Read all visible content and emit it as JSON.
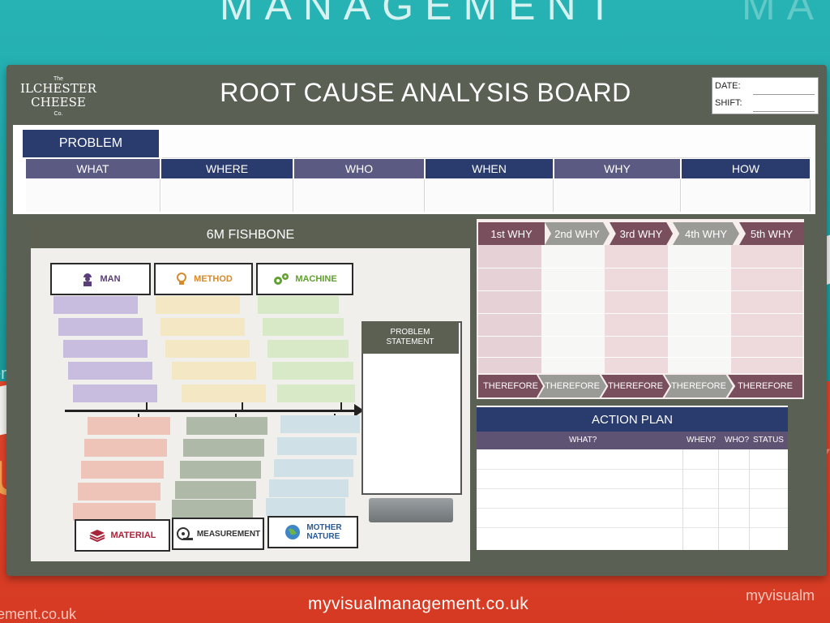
{
  "wall": {
    "top_text": "MANAGEMENT",
    "right_text": "MA",
    "left_text": "ent.c",
    "url": "myvisualmanagement.co.uk",
    "url_left": "ement.co.uk",
    "url_right": "myvisualm",
    "big_right": "Y",
    "big_left": "U"
  },
  "logo": {
    "line_small": "The",
    "line1": "ILCHESTER",
    "line2": "CHEESE",
    "line3": "Co."
  },
  "board": {
    "title": "ROOT CAUSE ANALYSIS BOARD",
    "date_label": "DATE:",
    "shift_label": "SHIFT:"
  },
  "problem": {
    "label": "PROBLEM",
    "columns": [
      "WHAT",
      "WHERE",
      "WHO",
      "WHEN",
      "WHY",
      "HOW"
    ]
  },
  "fishbone": {
    "title": "6M FISHBONE",
    "categories": {
      "man": "MAN",
      "method": "METHOD",
      "machine": "MACHINE",
      "material": "MATERIAL",
      "measurement": "MEASUREMENT",
      "mother_nature_1": "MOTHER",
      "mother_nature_2": "NATURE"
    },
    "problem_statement_1": "PROBLEM",
    "problem_statement_2": "STATEMENT"
  },
  "whys": {
    "headers": [
      "1st WHY",
      "2nd WHY",
      "3rd WHY",
      "4th WHY",
      "5th WHY"
    ],
    "therefore": [
      "THEREFORE",
      "THEREFORE",
      "THEREFORE",
      "THEREFORE",
      "THEREFORE"
    ]
  },
  "action_plan": {
    "title": "ACTION PLAN",
    "columns": [
      "WHAT?",
      "WHEN?",
      "WHO?",
      "STATUS"
    ]
  },
  "colors": {
    "navy": "#2a3b6e",
    "slate": "#5e5373",
    "board": "#5a6053",
    "why_dark": "#7a4f5d",
    "why_grey": "#9a9b96"
  }
}
